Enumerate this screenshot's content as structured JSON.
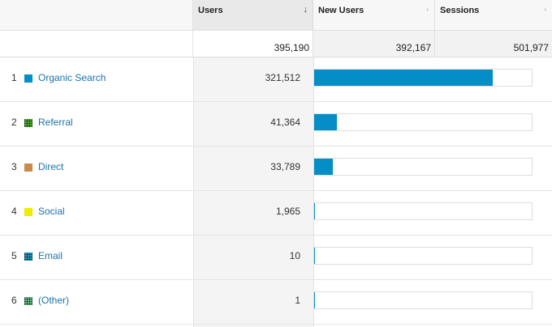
{
  "header": {
    "users_label": "Users",
    "new_users_label": "New Users",
    "sessions_label": "Sessions"
  },
  "totals": {
    "users": "395,190",
    "new_users": "392,167",
    "sessions": "501,977"
  },
  "rows": [
    {
      "rank": "1",
      "channel": "Organic Search",
      "users": "321,512",
      "users_value": 321512,
      "color": "#058dc7",
      "pattern": "solid"
    },
    {
      "rank": "2",
      "channel": "Referral",
      "users": "41,364",
      "users_value": 41364,
      "color": "#50b432",
      "pattern": "check"
    },
    {
      "rank": "3",
      "channel": "Direct",
      "users": "33,789",
      "users_value": 33789,
      "color": "#c98a4b",
      "pattern": "solid"
    },
    {
      "rank": "4",
      "channel": "Social",
      "users": "1,965",
      "users_value": 1965,
      "color": "#eded00",
      "pattern": "solid"
    },
    {
      "rank": "5",
      "channel": "Email",
      "users": "10",
      "users_value": 10,
      "color": "#24a0c8",
      "pattern": "check"
    },
    {
      "rank": "6",
      "channel": "(Other)",
      "users": "1",
      "users_value": 1,
      "color": "#64c08a",
      "pattern": "check"
    }
  ],
  "bar_scale_max": 395190,
  "icons": {
    "sort": "sort-down-arrow-icon",
    "column_menu": "column-options-icon"
  }
}
